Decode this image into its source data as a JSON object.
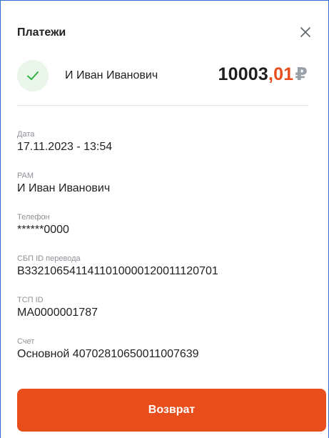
{
  "header": {
    "title": "Платежи"
  },
  "summary": {
    "status_icon": "check-icon",
    "payer_name": "И Иван Иванович",
    "amount_int": "10003",
    "amount_frac": ",01",
    "currency": "₽"
  },
  "fields": [
    {
      "label": "Дата",
      "value": "17.11.2023 - 13:54"
    },
    {
      "label": "PAM",
      "value": "И Иван Иванович"
    },
    {
      "label": "Телефон",
      "value": "******0000"
    },
    {
      "label": "СБП ID перевода",
      "value": "B3321065411411010000120011120701"
    },
    {
      "label": "ТСП ID",
      "value": "MA0000001787"
    },
    {
      "label": "Счет",
      "value": "Основной 40702810650011007639"
    }
  ],
  "actions": {
    "refund_label": "Возврат"
  },
  "colors": {
    "accent": "#e84d1c",
    "success_bg": "#e9f6e9",
    "success": "#2fb344"
  }
}
